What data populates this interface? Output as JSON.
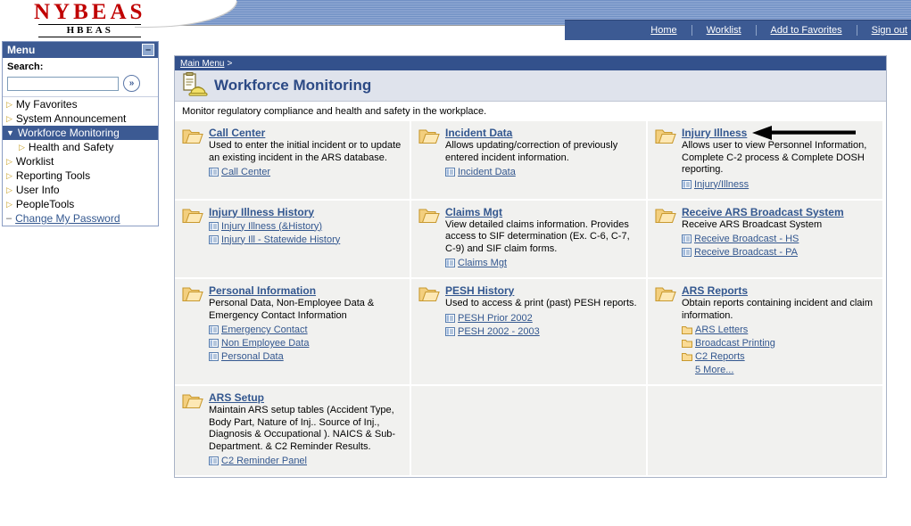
{
  "brand": {
    "logo_main": "NYBEAS",
    "logo_sub": "HBEAS"
  },
  "header": {
    "links": [
      {
        "label": "Home",
        "name": "home"
      },
      {
        "label": "Worklist",
        "name": "worklist"
      },
      {
        "label": "Add to Favorites",
        "name": "add-to-favorites"
      },
      {
        "label": "Sign out",
        "name": "sign-out"
      }
    ]
  },
  "sidebar": {
    "title": "Menu",
    "collapse_glyph": "–",
    "search_label": "Search:",
    "search_value": "",
    "search_placeholder": "",
    "go_glyph": "»",
    "items": [
      {
        "label": "My Favorites",
        "state": "closed",
        "level": 0,
        "selected": false,
        "link": false
      },
      {
        "label": "System Announcement",
        "state": "closed",
        "level": 0,
        "selected": false,
        "link": false
      },
      {
        "label": "Workforce Monitoring",
        "state": "open",
        "level": 0,
        "selected": true,
        "link": false
      },
      {
        "label": "Health and Safety",
        "state": "closed",
        "level": 1,
        "selected": false,
        "link": false
      },
      {
        "label": "Worklist",
        "state": "closed",
        "level": 0,
        "selected": false,
        "link": false
      },
      {
        "label": "Reporting Tools",
        "state": "closed",
        "level": 0,
        "selected": false,
        "link": false
      },
      {
        "label": "User Info",
        "state": "closed",
        "level": 0,
        "selected": false,
        "link": false
      },
      {
        "label": "PeopleTools",
        "state": "closed",
        "level": 0,
        "selected": false,
        "link": false
      },
      {
        "label": "Change My Password",
        "state": "leaf",
        "level": 0,
        "selected": false,
        "link": true
      }
    ]
  },
  "content": {
    "breadcrumb": "Main Menu",
    "breadcrumb_sep": ">",
    "page_title": "Workforce Monitoring",
    "page_description": "Monitor regulatory compliance and health and safety in the workplace.",
    "cells": [
      {
        "title": "Call Center",
        "desc": "Used to enter the initial incident or to update an existing incident in the ARS database.",
        "sublinks": [
          {
            "label": "Call Center",
            "icon": "page-icon"
          }
        ]
      },
      {
        "title": "Incident Data",
        "desc": "Allows updating/correction of previously entered incident information.",
        "sublinks": [
          {
            "label": "Incident Data",
            "icon": "page-icon"
          }
        ]
      },
      {
        "title": "Injury Illness",
        "desc": "Allows user to view Personnel Information, Complete C-2 process & Complete DOSH reporting.",
        "sublinks": [
          {
            "label": "Injury/Illness",
            "icon": "page-icon"
          }
        ],
        "annotated": true
      },
      {
        "title": "Injury Illness History",
        "desc": "",
        "sublinks": [
          {
            "label": "Injury Illness (&History)",
            "icon": "page-icon"
          },
          {
            "label": "Injury Ill - Statewide History",
            "icon": "page-icon"
          }
        ]
      },
      {
        "title": "Claims Mgt",
        "desc": "View detailed claims information. Provides access to SIF determination (Ex. C-6, C-7, C-9) and SIF claim forms.",
        "sublinks": [
          {
            "label": "Claims Mgt",
            "icon": "page-icon"
          }
        ]
      },
      {
        "title": "Receive ARS Broadcast System",
        "desc": "Receive ARS Broadcast System",
        "sublinks": [
          {
            "label": "Receive Broadcast - HS",
            "icon": "page-icon"
          },
          {
            "label": "Receive Broadcast - PA",
            "icon": "page-icon"
          }
        ]
      },
      {
        "title": "Personal Information",
        "desc": "Personal Data, Non-Employee Data & Emergency Contact Information",
        "sublinks": [
          {
            "label": "Emergency Contact",
            "icon": "page-icon"
          },
          {
            "label": "Non Employee Data",
            "icon": "page-icon"
          },
          {
            "label": "Personal Data",
            "icon": "page-icon"
          }
        ]
      },
      {
        "title": "PESH History",
        "desc": "Used to access & print (past) PESH reports.",
        "sublinks": [
          {
            "label": "PESH Prior 2002",
            "icon": "page-icon"
          },
          {
            "label": "PESH 2002 - 2003",
            "icon": "page-icon"
          }
        ]
      },
      {
        "title": "ARS Reports",
        "desc": "Obtain reports containing incident and claim information.",
        "sublinks": [
          {
            "label": "ARS Letters",
            "icon": "folder-icon"
          },
          {
            "label": "Broadcast Printing",
            "icon": "folder-icon"
          },
          {
            "label": "C2 Reports",
            "icon": "folder-icon"
          },
          {
            "label": "5 More...",
            "icon": "none"
          }
        ]
      },
      {
        "title": "ARS Setup",
        "desc": "Maintain ARS setup tables (Accident Type, Body Part, Nature of Inj.. Source of Inj., Diagnosis & Occupational ). NAICS & Sub-Department. & C2 Reminder Results.",
        "sublinks": [
          {
            "label": "C2 Reminder Panel",
            "icon": "page-icon"
          }
        ]
      },
      {
        "title": "",
        "desc": "",
        "sublinks": [],
        "empty": true
      },
      {
        "title": "",
        "desc": "",
        "sublinks": [],
        "empty": true
      }
    ]
  },
  "colors": {
    "brand_red": "#c00000",
    "nav_blue": "#3c5a93",
    "link_blue": "#33578f",
    "cell_bg": "#f1f1ef",
    "title_bar": "#dfe3ec"
  }
}
